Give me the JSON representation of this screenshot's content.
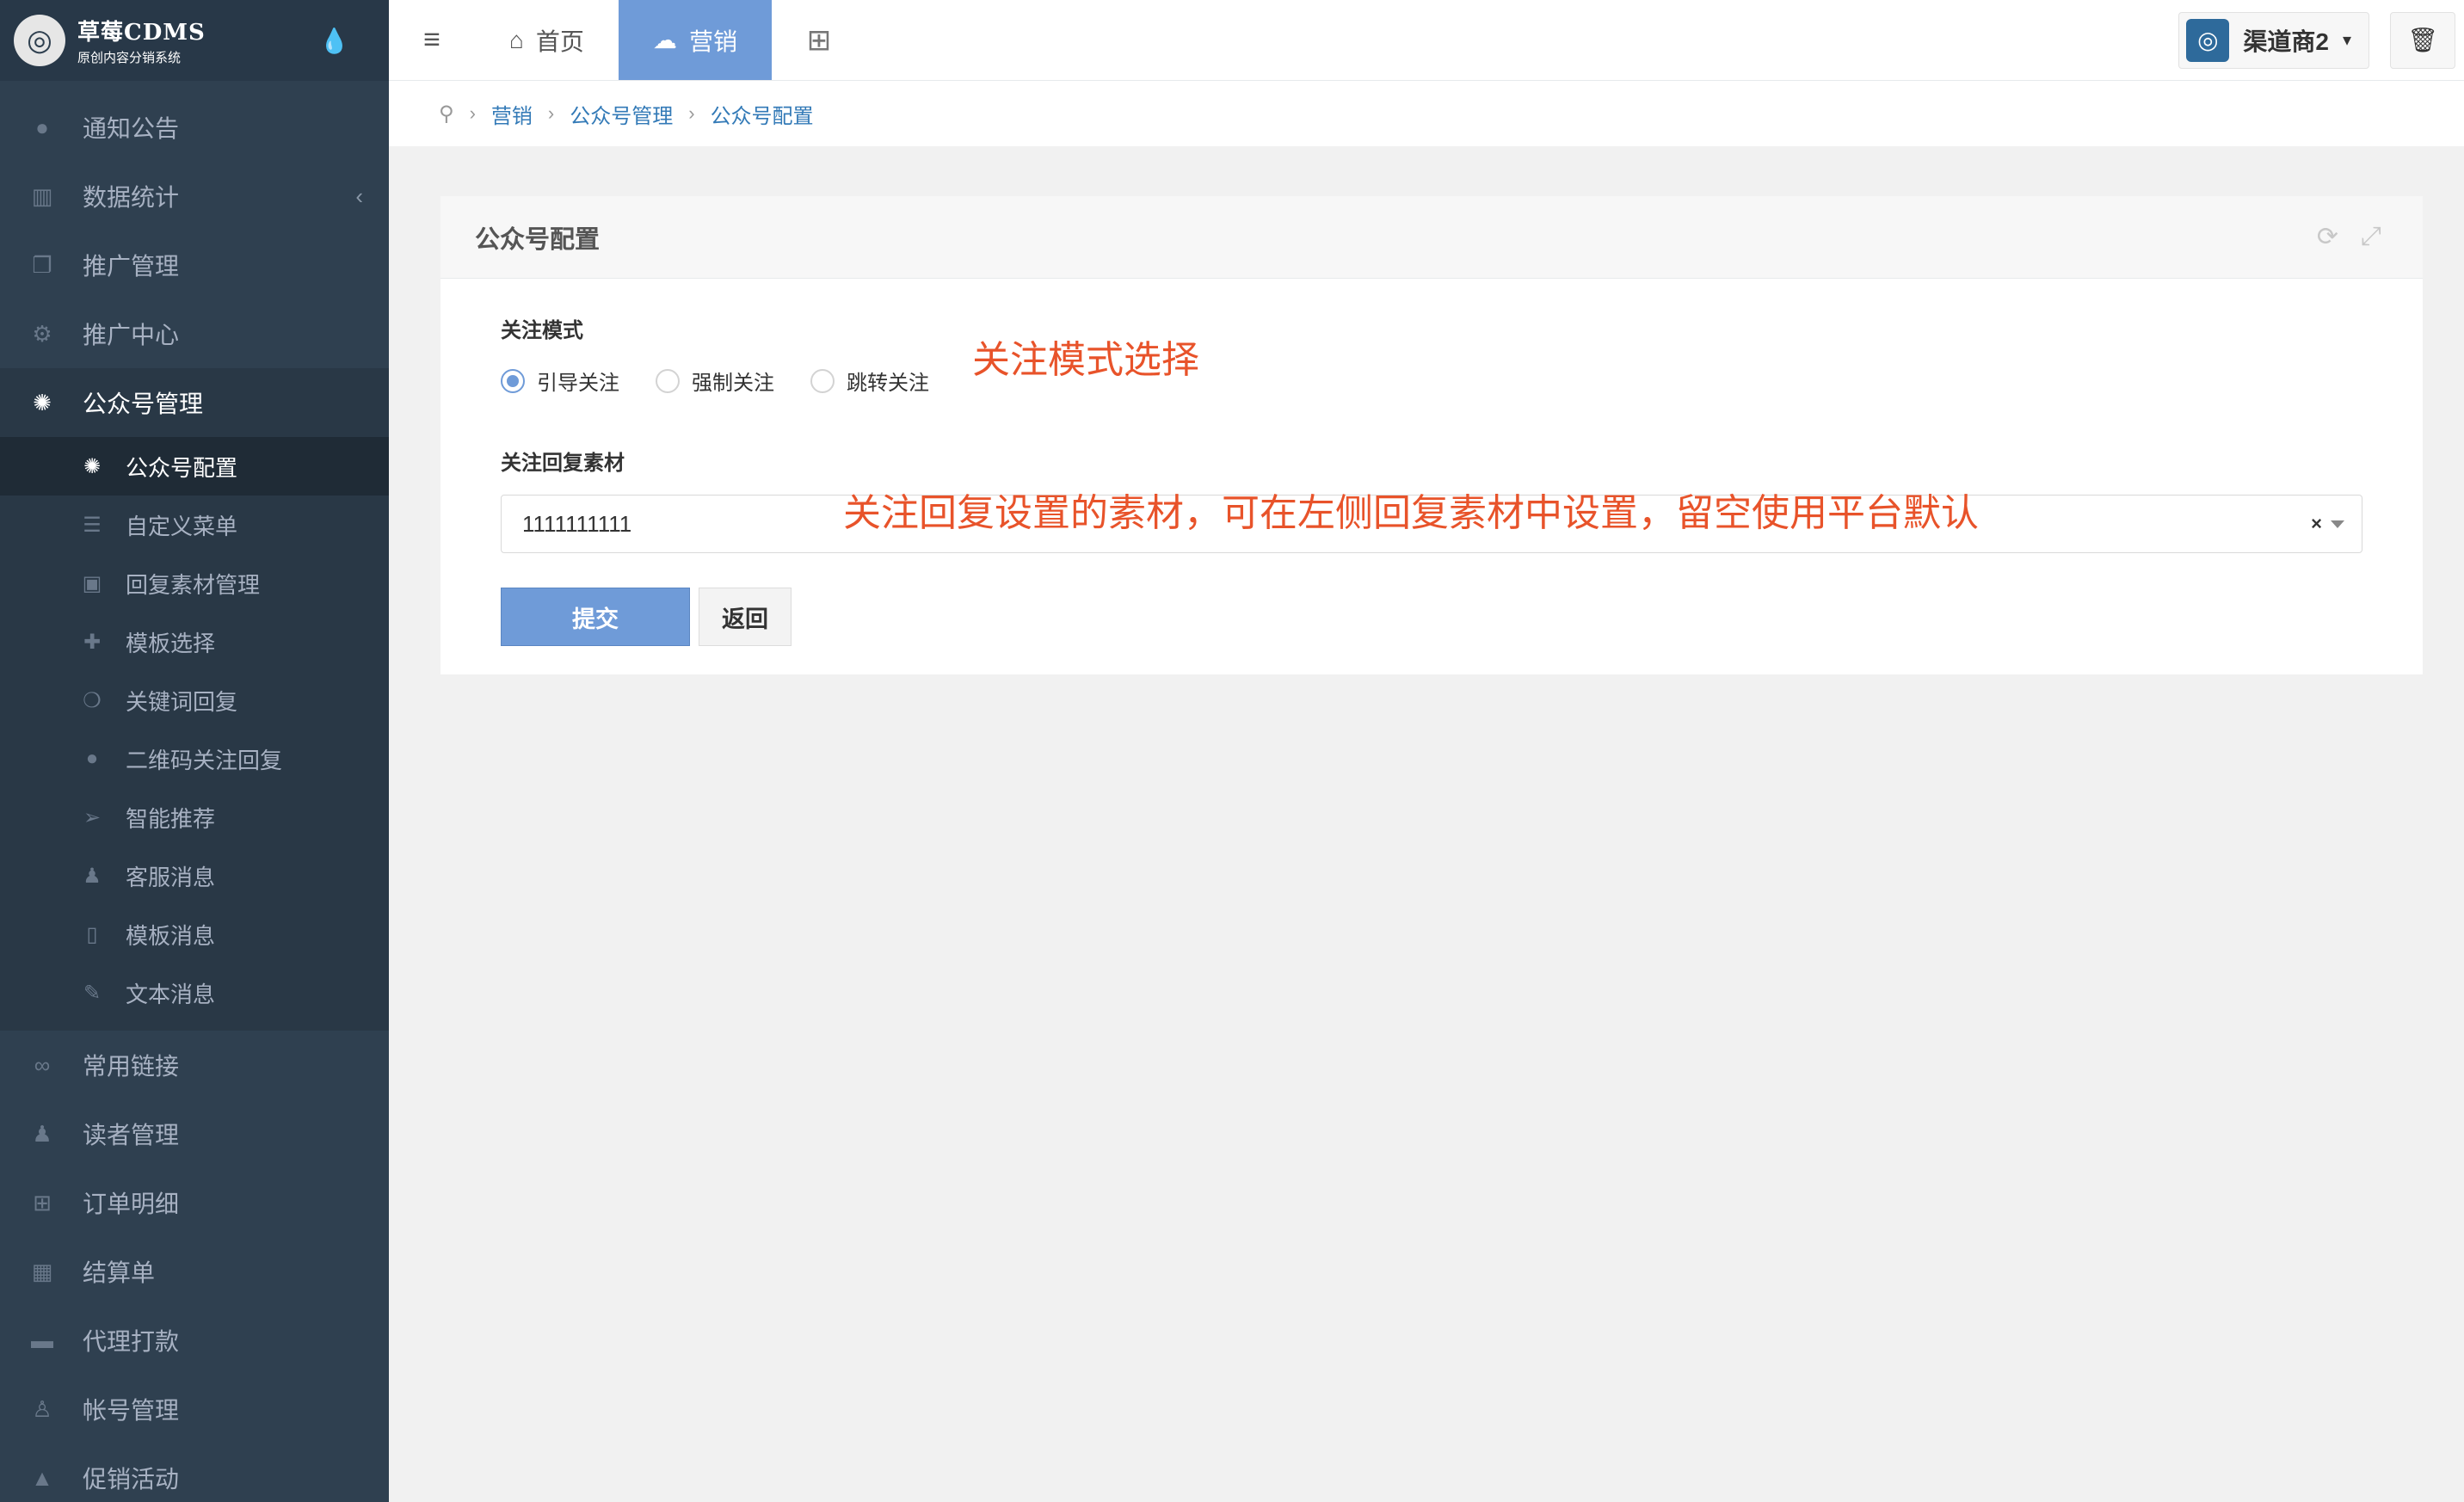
{
  "brand": {
    "title": "草莓CDMS",
    "subtitle": "原创内容分销系统",
    "logo_glyph": "◎"
  },
  "sidebar": {
    "items": [
      {
        "label": "通知公告",
        "icon": "chat-bubble-icon",
        "glyph": "●"
      },
      {
        "label": "数据统计",
        "icon": "bar-chart-icon",
        "glyph": "▥",
        "chevron": "‹"
      },
      {
        "label": "推广管理",
        "icon": "stack-icon",
        "glyph": "❐"
      },
      {
        "label": "推广中心",
        "icon": "settings-icon",
        "glyph": "⚙"
      },
      {
        "label": "公众号管理",
        "icon": "wechat-icon",
        "glyph": "✺"
      }
    ],
    "subitems": [
      {
        "label": "公众号配置",
        "icon": "wechat-icon",
        "glyph": "✺"
      },
      {
        "label": "自定义菜单",
        "icon": "list-icon",
        "glyph": "☰"
      },
      {
        "label": "回复素材管理",
        "icon": "image-icon",
        "glyph": "▣"
      },
      {
        "label": "模板选择",
        "icon": "puzzle-icon",
        "glyph": "✚"
      },
      {
        "label": "关键词回复",
        "icon": "comments-icon",
        "glyph": "❍"
      },
      {
        "label": "二维码关注回复",
        "icon": "comment-icon",
        "glyph": "●"
      },
      {
        "label": "智能推荐",
        "icon": "paper-plane-icon",
        "glyph": "➢"
      },
      {
        "label": "客服消息",
        "icon": "user-icon",
        "glyph": "♟"
      },
      {
        "label": "模板消息",
        "icon": "file-icon",
        "glyph": "▯"
      },
      {
        "label": "文本消息",
        "icon": "edit-icon",
        "glyph": "✎"
      }
    ],
    "items_after": [
      {
        "label": "常用链接",
        "icon": "link-icon",
        "glyph": "∞"
      },
      {
        "label": "读者管理",
        "icon": "users-icon",
        "glyph": "♟"
      },
      {
        "label": "订单明细",
        "icon": "cart-icon",
        "glyph": "⊞"
      },
      {
        "label": "结算单",
        "icon": "calculator-icon",
        "glyph": "▦"
      },
      {
        "label": "代理打款",
        "icon": "visa-card-icon",
        "glyph": "▬"
      },
      {
        "label": "帐号管理",
        "icon": "user-icon",
        "glyph": "♙"
      },
      {
        "label": "促销活动",
        "icon": "shopping-bag-icon",
        "glyph": "▲"
      }
    ]
  },
  "topbar": {
    "menu_glyph": "≡",
    "tabs": [
      {
        "label": "首页",
        "glyph": "⌂"
      },
      {
        "label": "营销",
        "glyph": "☁"
      }
    ],
    "grid_glyph": "⊞",
    "user": {
      "name": "渠道商2",
      "caret": "▾",
      "avatar_glyph": "◎"
    },
    "trash_glyph": "🗑"
  },
  "breadcrumb": {
    "pin": "⚲",
    "sep": "›",
    "items": [
      "营销",
      "公众号管理",
      "公众号配置"
    ]
  },
  "panel": {
    "title": "公众号配置",
    "tools": {
      "refresh": "⟳",
      "expand": "⤢"
    },
    "follow_mode_label": "关注模式",
    "follow_mode_options": [
      "引导关注",
      "强制关注",
      "跳转关注"
    ],
    "follow_mode_selected": "引导关注",
    "follow_mode_annotation": "关注模式选择",
    "reply_material_label": "关注回复素材",
    "reply_material_value": "1111111111",
    "reply_material_clear": "×",
    "reply_material_annotation": "关注回复设置的素材，可在左侧回复素材中设置，留空使用平台默认",
    "submit": "提交",
    "back": "返回"
  },
  "colors": {
    "sidebar_bg": "#2f4050",
    "accent": "#6f9bd8",
    "annotation": "#e8532a"
  }
}
